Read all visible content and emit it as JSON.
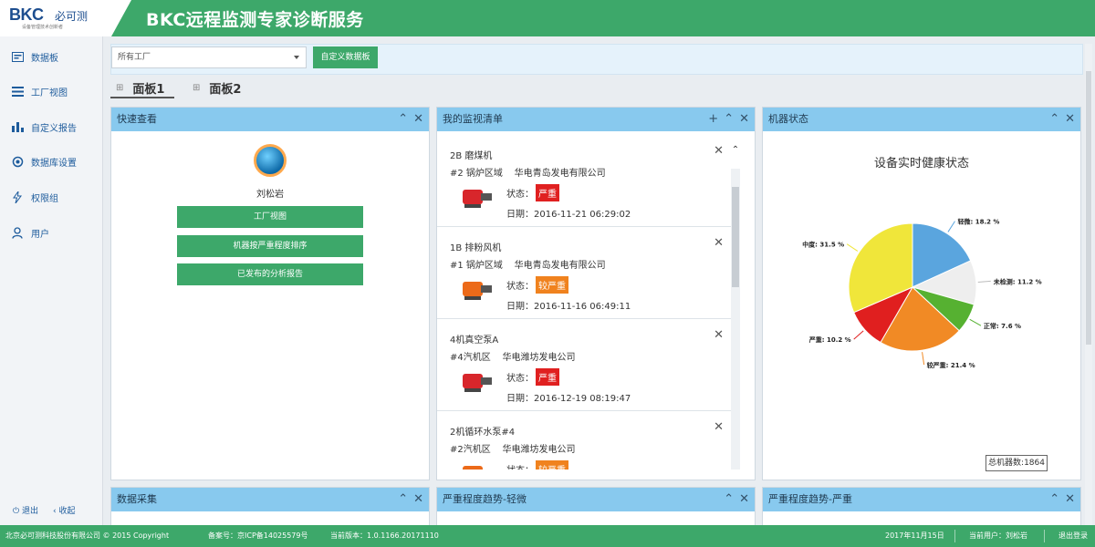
{
  "header": {
    "logo_text": "BKC",
    "logo_cn": "必可测",
    "logo_sub": "设备管理技术创新者",
    "title": "BKC远程监测专家诊断服务"
  },
  "sidebar": {
    "items": [
      {
        "label": "数据板",
        "icon": "dashboard-icon"
      },
      {
        "label": "工厂视图",
        "icon": "factory-list-icon"
      },
      {
        "label": "自定义报告",
        "icon": "bar-chart-icon"
      },
      {
        "label": "数据库设置",
        "icon": "settings-icon"
      },
      {
        "label": "权限组",
        "icon": "lightning-icon"
      },
      {
        "label": "用户",
        "icon": "user-icon"
      }
    ],
    "logout": "退出",
    "collapse": "收起"
  },
  "filter": {
    "factory_select": "所有工厂",
    "custom_button": "自定义数据板"
  },
  "tabs": [
    {
      "label": "面板1",
      "active": true
    },
    {
      "label": "面板2",
      "active": false
    }
  ],
  "quick_view": {
    "title": "快速查看",
    "user_name": "刘松岩",
    "buttons": [
      "工厂视图",
      "机器按严重程度排序",
      "已发布的分析报告"
    ]
  },
  "watch_list": {
    "title": "我的监视清单",
    "status_label": "状态：",
    "date_label": "日期：",
    "items": [
      {
        "name": "2B 磨煤机",
        "area": "#2 锅炉区域",
        "company": "华电青岛发电有限公司",
        "status": "严重",
        "status_color": "#e02020",
        "date": "2016-11-21 06:29:02",
        "machine_color": "#d8262b"
      },
      {
        "name": "1B 排粉风机",
        "area": "#1 锅炉区域",
        "company": "华电青岛发电有限公司",
        "status": "较严重",
        "status_color": "#f0821e",
        "date": "2016-11-16 06:49:11",
        "machine_color": "#ec6a19"
      },
      {
        "name": "4机真空泵A",
        "area": "#4汽机区",
        "company": "华电潍坊发电公司",
        "status": "严重",
        "status_color": "#e02020",
        "date": "2016-12-19 08:19:47",
        "machine_color": "#d8262b"
      },
      {
        "name": "2机循环水泵#4",
        "area": "#2汽机区",
        "company": "华电潍坊发电公司",
        "status": "较严重",
        "status_color": "#f0821e",
        "date": "",
        "machine_color": "#ec6a19"
      }
    ]
  },
  "machine_status": {
    "title": "机器状态",
    "chart_title": "设备实时健康状态",
    "total_label": "总机器数:1864"
  },
  "chart_data": {
    "type": "pie",
    "title": "设备实时健康状态",
    "slices": [
      {
        "label": "轻微",
        "value": 18.2,
        "text": "轻微: 18.2 %",
        "color": "#5aa5de"
      },
      {
        "label": "未检测",
        "value": 11.2,
        "text": "未检测: 11.2 %",
        "color": "#eeeeee"
      },
      {
        "label": "正常",
        "value": 7.6,
        "text": "正常: 7.6 %",
        "color": "#56b131"
      },
      {
        "label": "较严重",
        "value": 21.4,
        "text": "较严重: 21.4 %",
        "color": "#f18a25"
      },
      {
        "label": "严重",
        "value": 10.2,
        "text": "严重: 10.2 %",
        "color": "#e01f1f"
      },
      {
        "label": "中度",
        "value": 31.5,
        "text": "中度: 31.5 %",
        "color": "#f0e63a"
      }
    ]
  },
  "bottom_panels": [
    "数据采集",
    "严重程度趋势-轻微",
    "严重程度趋势-严重"
  ],
  "footer": {
    "company": "北京必可测科技股份有限公司 © 2015 Copyright",
    "icp": "备案号：京ICP备14025579号",
    "version": "当前版本：1.0.1166.20171110",
    "date": "2017年11月15日",
    "current_user": "当前用户：刘松岩",
    "logout": "退出登录"
  }
}
